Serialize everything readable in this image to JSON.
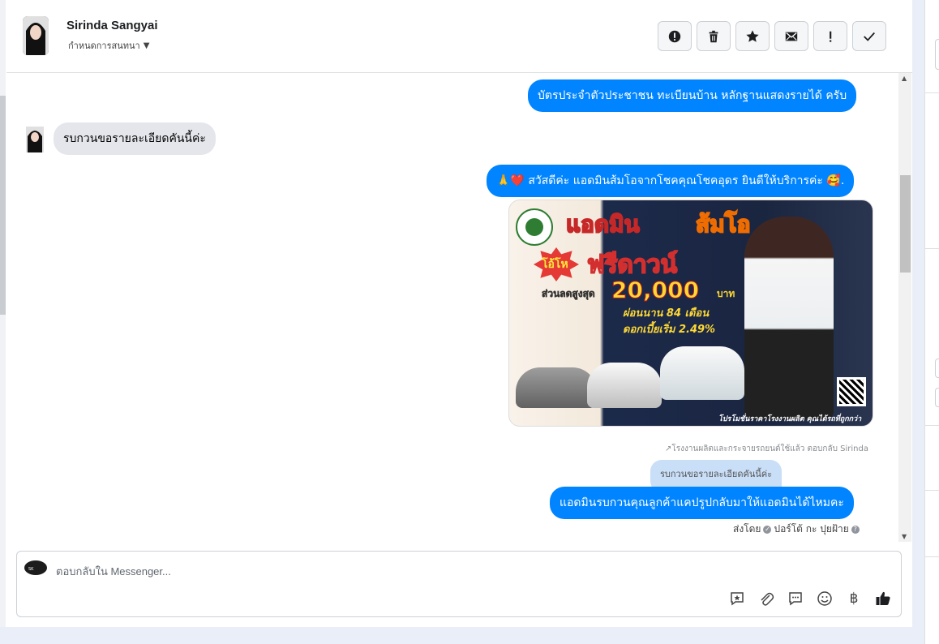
{
  "header": {
    "contact_name": "Sirinda Sangyai",
    "assign_label": "กำหนดการสนทนา",
    "toolbar": [
      {
        "icon": "alert-circle-icon",
        "name": "mark-spam-button"
      },
      {
        "icon": "trash-icon",
        "name": "delete-button"
      },
      {
        "icon": "star-icon",
        "name": "star-button"
      },
      {
        "icon": "mail-unread-icon",
        "name": "mark-unread-button"
      },
      {
        "icon": "exclamation-icon",
        "name": "follow-up-button"
      },
      {
        "icon": "check-icon",
        "name": "done-button"
      }
    ]
  },
  "messages": {
    "m1_out": "บัตรประจำตัวประชาชน ทะเบียนบ้าน หลักฐานแสดงรายได้ ครับ",
    "m2_in": "รบกวนขอรายละเอียดคันนี้ค่ะ",
    "m3_out": "🙏❤️ สวัสดีค่ะ แอดมินส้มโอจากโชคคุณโชคอุดร ยินดีให้บริการค่ะ 🥰.",
    "reply_meta": "โรงงานผลิตและกระจายรถยนต์ใช้แล้ว ตอบกลับ Sirinda",
    "quoted_text": "รบกวนขอรายละเอียดคันนี้ค่ะ",
    "m4_out": "แอดมินรบกวนคุณลูกค้าแคปรูปกลับมาให้แอดมินได้ไหมคะ",
    "sent_by_prefix": "ส่งโดย",
    "sent_by_name": "ปอร์โต้ กะ ปุยฝ้าย"
  },
  "promo": {
    "title_left": "แอดมิน",
    "title_right": "ส้มโอ",
    "badge": "โอ้โห",
    "free_down": "ฟรีดาวน์",
    "discount_label": "ส่วนลดสูงสุด",
    "discount_amount": "20,000",
    "discount_unit": "บาท",
    "installment": "ผ่อนนาน 84 เดือน",
    "interest": "ดอกเบี้ยเริ่ม 2.49%",
    "footer": "โปรโมชั่นราคาโรงงานผลิต คุณได้รถที่ถูกกว่า"
  },
  "composer": {
    "placeholder": "ตอบกลับใน Messenger...",
    "icons": [
      "saved-reply-icon",
      "attachment-icon",
      "chat-icon",
      "emoji-icon",
      "baht-icon",
      "thumbs-up-icon"
    ]
  },
  "colors": {
    "outgoing": "#0084ff",
    "incoming": "#e4e6eb",
    "quoted": "#c9def7"
  }
}
